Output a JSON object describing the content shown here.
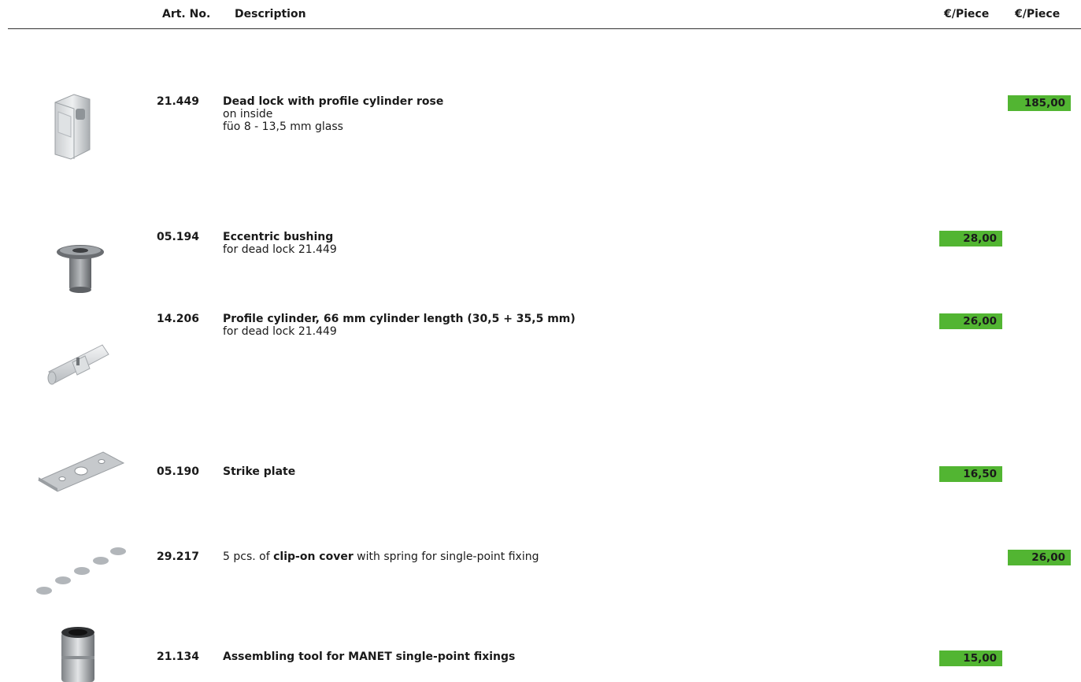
{
  "header": {
    "art_no": "Art. No.",
    "description": "Description",
    "price1": "€/Piece",
    "price2": "€/Piece"
  },
  "items": [
    {
      "art_no": "21.449",
      "title": "Dead lock with profile cylinder rose",
      "lines": [
        "on inside",
        "füo 8 - 13,5 mm glass"
      ],
      "price": "185,00",
      "price_column": 2,
      "icon": "dead-lock-icon"
    },
    {
      "art_no": "05.194",
      "title": "Eccentric bushing",
      "lines": [
        "for dead lock 21.449"
      ],
      "price": "28,00",
      "price_column": 1,
      "icon": "bushing-icon"
    },
    {
      "art_no": "14.206",
      "title": "Profile cylinder, 66 mm cylinder length (30,5 + 35,5 mm)",
      "lines": [
        "for dead lock 21.449"
      ],
      "price": "26,00",
      "price_column": 1,
      "icon": "cylinder-icon"
    },
    {
      "art_no": "05.190",
      "title": "Strike plate",
      "lines": [],
      "price": "16,50",
      "price_column": 1,
      "icon": "strike-plate-icon"
    },
    {
      "art_no": "29.217",
      "desc_prefix": "5 pcs. of ",
      "title": "clip-on cover",
      "desc_suffix": " with spring for single-point fixing",
      "price": "26,00",
      "price_column": 2,
      "icon": "clip-covers-icon"
    },
    {
      "art_no": "21.134",
      "title": "Assembling tool for MANET single-point fixings",
      "lines": [],
      "price": "15,00",
      "price_column": 1,
      "icon": "assembling-tool-icon"
    }
  ],
  "colors": {
    "price_bg": "#52b532",
    "rule": "#333333",
    "text": "#1a1a1a"
  }
}
